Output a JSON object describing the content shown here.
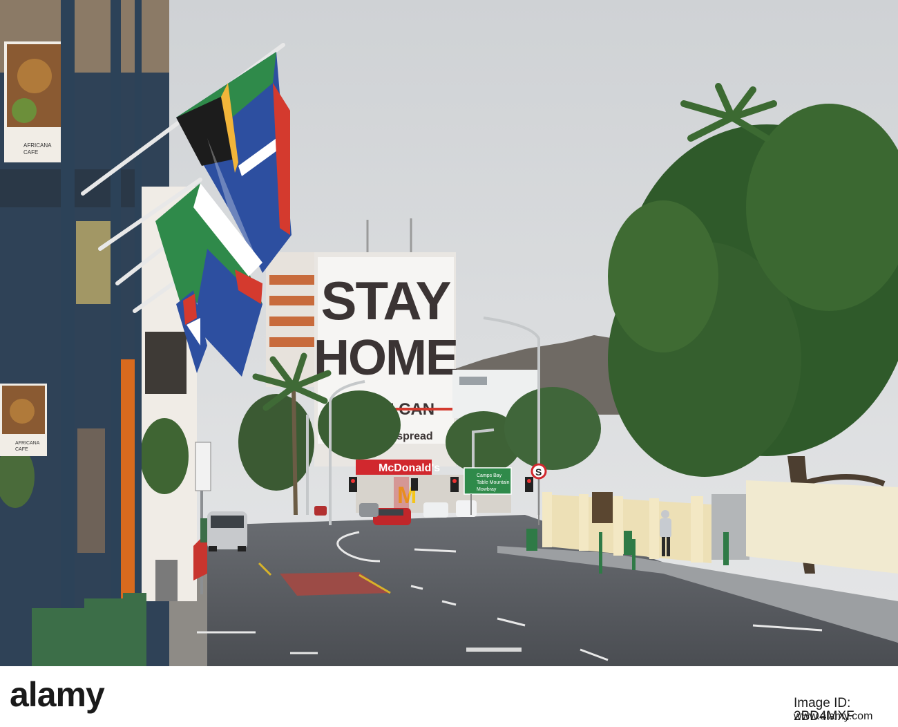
{
  "billboard": {
    "line1": "STAY",
    "line2": "HOME",
    "line3": "IF YOU CAN",
    "hashtag": "#flattenthespread"
  },
  "storefront": {
    "sign": "McDonald's",
    "logo": "M"
  },
  "cafe": {
    "name_top": "AFRICANA",
    "sub_top": "CAFE",
    "name_bottom": "AFRICANA",
    "sub_bottom": "CAFE"
  },
  "road_sign": {
    "row1": "Camps Bay",
    "row2": "Table Mountain",
    "row3": "Mowbray"
  },
  "no_stopping_sign": "S",
  "watermark": {
    "logo": "alamy",
    "image_id": "Image ID: 2BD4MXF",
    "url": "www.alamy.com"
  },
  "colors": {
    "sky": "#d9dbdd",
    "road": "#56595e",
    "tree_green": "#2f5a2a",
    "flag_green": "#2f8a4a",
    "flag_blue": "#2d4fa0",
    "flag_red": "#d43a2e",
    "flag_gold": "#f2b53a",
    "mcdonalds_red": "#d1282e",
    "mcdonalds_yellow": "#f5c518",
    "pillar_green": "#3c6e48"
  }
}
